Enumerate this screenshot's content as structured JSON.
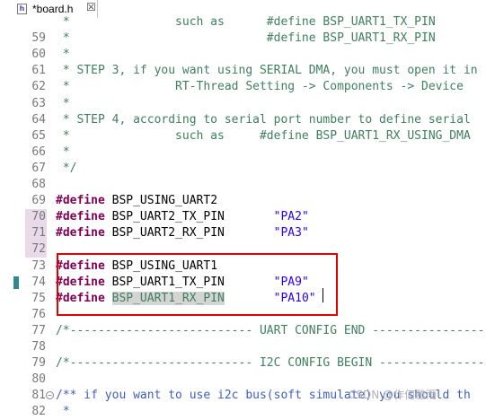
{
  "tab": {
    "title": "*board.h",
    "file_icon": "h-file-icon",
    "close_glyph": "☒"
  },
  "lines": [
    {
      "n": "",
      "parts": [
        [
          "cm",
          " *               such as      #define BSP_UART1_TX_PIN"
        ]
      ]
    },
    {
      "n": "59",
      "parts": [
        [
          "cm",
          " *                            #define BSP_UART1_RX_PIN"
        ]
      ]
    },
    {
      "n": "60",
      "parts": [
        [
          "cm",
          " *"
        ]
      ]
    },
    {
      "n": "61",
      "parts": [
        [
          "cm",
          " * STEP 3, if you want using SERIAL DMA, you must open it in"
        ]
      ]
    },
    {
      "n": "62",
      "parts": [
        [
          "cm",
          " *               RT-Thread Setting -> Components -> Device"
        ]
      ]
    },
    {
      "n": "63",
      "parts": [
        [
          "cm",
          " *"
        ]
      ]
    },
    {
      "n": "64",
      "parts": [
        [
          "cm",
          " * STEP 4, according to serial port number to define serial"
        ]
      ]
    },
    {
      "n": "65",
      "parts": [
        [
          "cm",
          " *               such as     #define BSP_UART1_RX_USING_DMA"
        ]
      ]
    },
    {
      "n": "66",
      "parts": [
        [
          "cm",
          " *"
        ]
      ]
    },
    {
      "n": "67",
      "parts": [
        [
          "cm",
          " */"
        ]
      ]
    },
    {
      "n": "68",
      "parts": []
    },
    {
      "n": "69",
      "parts": [
        [
          "kw",
          "#define"
        ],
        [
          "tx",
          " BSP_USING_UART2"
        ]
      ]
    },
    {
      "n": "70",
      "hl": true,
      "parts": [
        [
          "kw",
          "#define"
        ],
        [
          "tx",
          " BSP_UART2_TX_PIN       "
        ],
        [
          "str",
          "\"PA2\""
        ]
      ]
    },
    {
      "n": "71",
      "hl": true,
      "parts": [
        [
          "kw",
          "#define"
        ],
        [
          "tx",
          " BSP_UART2_RX_PIN       "
        ],
        [
          "str",
          "\"PA3\""
        ]
      ]
    },
    {
      "n": "72",
      "hl": true,
      "parts": []
    },
    {
      "n": "73",
      "parts": [
        [
          "kw",
          "#define"
        ],
        [
          "tx",
          " BSP_USING_UART1"
        ]
      ]
    },
    {
      "n": "74",
      "marker": true,
      "parts": [
        [
          "kw",
          "#define"
        ],
        [
          "tx",
          " BSP_UART1_TX_PIN       "
        ],
        [
          "str",
          "\"PA9\""
        ]
      ]
    },
    {
      "n": "75",
      "parts": [
        [
          "kw",
          "#define"
        ],
        [
          "tx",
          " "
        ],
        [
          "sel",
          "BSP_UART1_RX_PIN"
        ],
        [
          "tx",
          "       "
        ],
        [
          "str",
          "\"PA10\""
        ]
      ]
    },
    {
      "n": "76",
      "parts": []
    },
    {
      "n": "77",
      "parts": [
        [
          "cm",
          "/*-------------------------- UART CONFIG END -----------------"
        ]
      ]
    },
    {
      "n": "78",
      "parts": []
    },
    {
      "n": "79",
      "parts": [
        [
          "cm",
          "/*-------------------------- I2C CONFIG BEGIN ----------------"
        ]
      ]
    },
    {
      "n": "80",
      "parts": []
    },
    {
      "n": "81",
      "fold": true,
      "parts": [
        [
          "cmblue",
          "/** if you want to use i2c bus(soft simulate) you should th"
        ]
      ]
    },
    {
      "n": "82",
      "parts": [
        [
          "cmblue",
          " *"
        ]
      ]
    }
  ],
  "watermark": "CSDN @作何雅雨"
}
